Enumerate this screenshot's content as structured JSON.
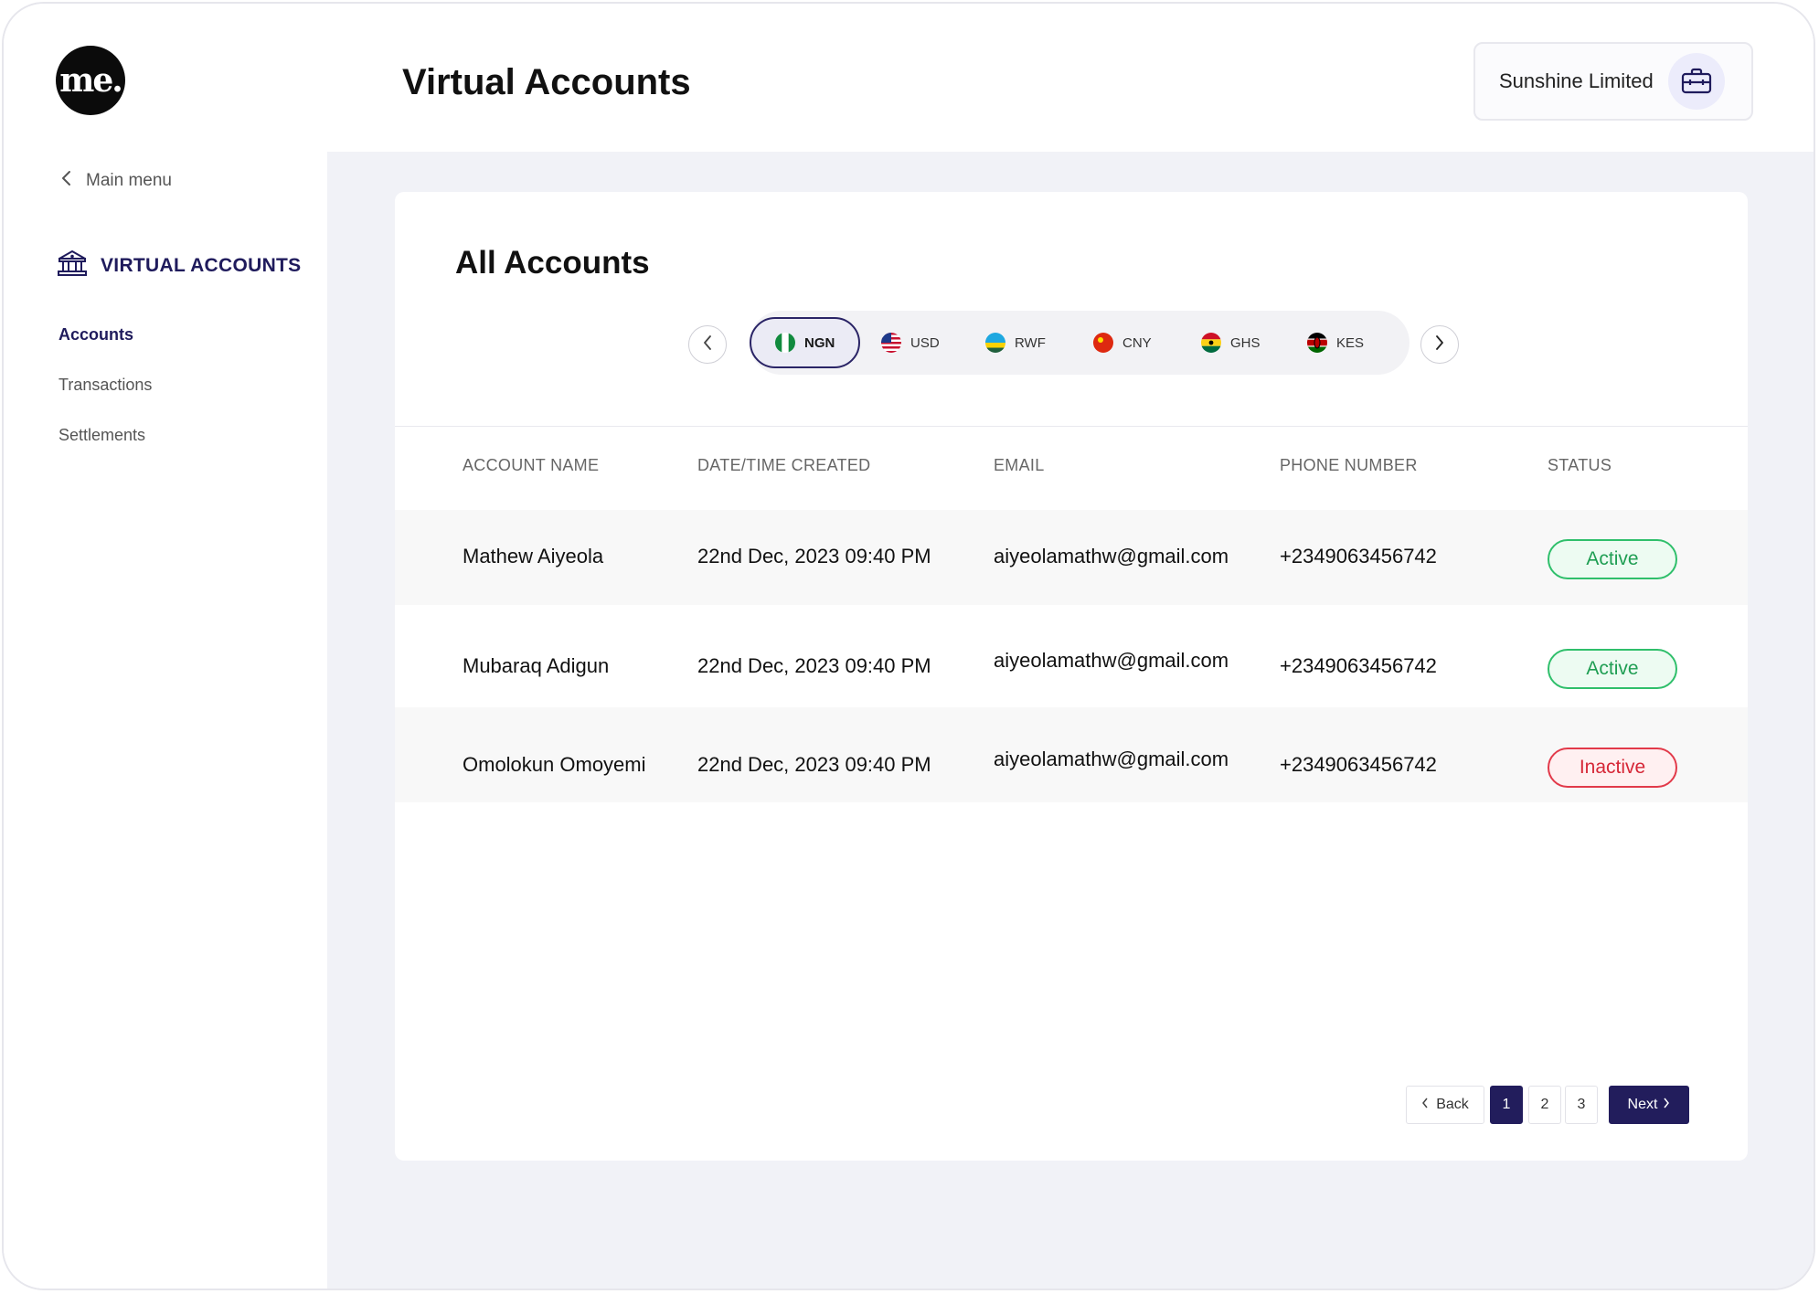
{
  "brand": {
    "logo_text": "me."
  },
  "header": {
    "title": "Virtual Accounts",
    "organization": "Sunshine Limited"
  },
  "sidebar": {
    "back_label": "Main menu",
    "section_title": "VIRTUAL ACCOUNTS",
    "items": [
      {
        "label": "Accounts",
        "active": true
      },
      {
        "label": "Transactions",
        "active": false
      },
      {
        "label": "Settlements",
        "active": false
      }
    ]
  },
  "card": {
    "title": "All Accounts",
    "currencies": [
      {
        "code": "NGN",
        "active": true
      },
      {
        "code": "USD",
        "active": false
      },
      {
        "code": "RWF",
        "active": false
      },
      {
        "code": "CNY",
        "active": false
      },
      {
        "code": "GHS",
        "active": false
      },
      {
        "code": "KES",
        "active": false
      }
    ]
  },
  "table": {
    "columns": [
      "ACCOUNT NAME",
      "DATE/TIME CREATED",
      "EMAIL",
      "PHONE NUMBER",
      "STATUS"
    ],
    "rows": [
      {
        "name": "Mathew Aiyeola",
        "created": "22nd Dec, 2023 09:40 PM",
        "email": "aiyeolamathw@gmail.com",
        "phone": "+2349063456742",
        "status": "Active"
      },
      {
        "name": "Mubaraq Adigun",
        "created": "22nd Dec, 2023 09:40 PM",
        "email": "aiyeolamathw@gmail.com",
        "phone": "+2349063456742",
        "status": "Active"
      },
      {
        "name": "Omolokun Omoyemi",
        "created": "22nd Dec, 2023 09:40 PM",
        "email": "aiyeolamathw@gmail.com",
        "phone": "+2349063456742",
        "status": "Inactive"
      }
    ]
  },
  "pagination": {
    "back_label": "Back",
    "pages": [
      "1",
      "2",
      "3"
    ],
    "current_page": "1",
    "next_label": "Next"
  },
  "colors": {
    "brand_navy": "#221d5c",
    "active_green": "#1f9e53",
    "inactive_red": "#d62737",
    "content_bg": "#f1f2f7"
  }
}
